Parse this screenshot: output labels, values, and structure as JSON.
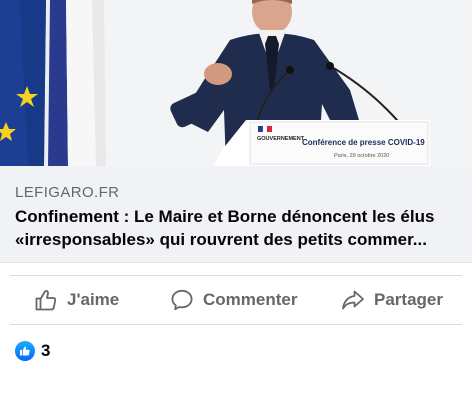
{
  "photo": {
    "alt_subject": "press-conference-photo",
    "podium_sign": {
      "brand": "GOUVERNEMENT",
      "title": "Conférence de presse COVID-19",
      "subtitle": "Paris, 29 octobre 2020"
    }
  },
  "link_preview": {
    "domain": "LEFIGARO.FR",
    "headline_line1": "Confinement : Le Maire et Borne dénoncent les élus",
    "headline_line2": "«irresponsables» qui rouvrent des petits commer..."
  },
  "actions": {
    "like_label": "J'aime",
    "comment_label": "Commenter",
    "share_label": "Partager"
  },
  "reactions": {
    "count": "3"
  },
  "colors": {
    "link_bg": "#f0f2f5",
    "action_text": "#65676b",
    "like_blue": "#0866ff"
  }
}
